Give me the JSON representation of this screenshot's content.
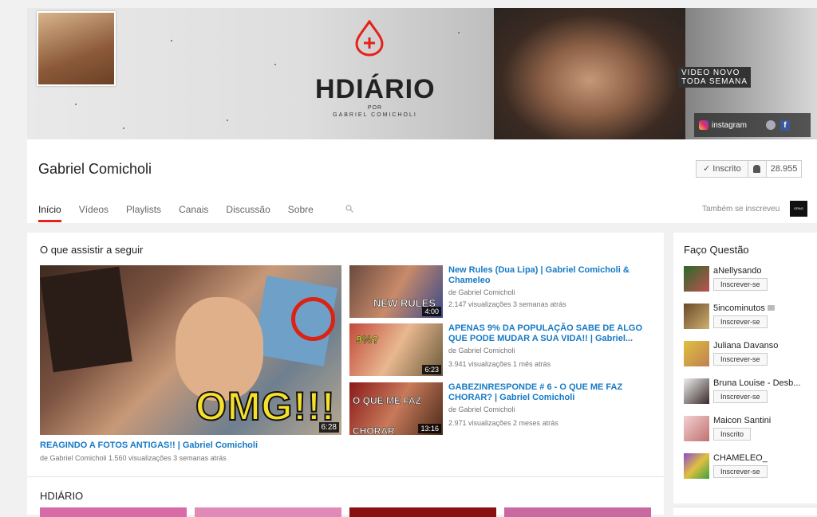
{
  "banner": {
    "logo_title": "HDIÁRIO",
    "logo_por": "POR",
    "logo_sub": "GABRIEL COMICHOLI",
    "video_novo_line1": "VIDEO NOVO",
    "video_novo_line2": "TODA SEMANA",
    "instagram_label": "instagram",
    "globe_icon": "globe-icon",
    "facebook_icon": "facebook-icon"
  },
  "header": {
    "channel_name": "Gabriel Comicholi",
    "subscribed_label": "✓ Inscrito",
    "subscriber_count": "28.955",
    "also_subscribed": "Também se inscreveu",
    "also_thumb_text": "GRAG"
  },
  "tabs": [
    {
      "label": "Início",
      "active": true
    },
    {
      "label": "Vídeos"
    },
    {
      "label": "Playlists"
    },
    {
      "label": "Canais"
    },
    {
      "label": "Discussão"
    },
    {
      "label": "Sobre"
    }
  ],
  "main": {
    "section_title": "O que assistir a seguir",
    "featured": {
      "title": "REAGINDO A FOTOS ANTIGAS!! | Gabriel Comicholi",
      "meta": "de Gabriel Comicholi  1.560 visualizações  3 semanas atrás",
      "duration": "6:28",
      "overlay_text": "OMG!!!"
    },
    "videos": [
      {
        "title": "New Rules (Dua Lipa) | Gabriel Comicholi & Chameleo",
        "by": "de Gabriel Comicholi",
        "stats": "2.147 visualizações  3 semanas atrás",
        "duration": "4:00",
        "thumb_text": "NEW RULES"
      },
      {
        "title": "APENAS 9% DA POPULAÇÃO SABE DE ALGO QUE PODE MUDAR A SUA VIDA!! | Gabriel...",
        "by": "de Gabriel Comicholi",
        "stats": "3.941 visualizações  1 mês atrás",
        "duration": "6:23",
        "thumb_text": "9%?"
      },
      {
        "title": "GABEZINRESPONDE # 6 - O QUE ME FAZ CHORAR? | Gabriel Comicholi",
        "by": "de Gabriel Comicholi",
        "stats": "2.971 visualizações  2 meses atrás",
        "duration": "13:16",
        "thumb_text": "O QUE ME FAZ CHORAR"
      }
    ],
    "second_section_title": "HDIÁRIO"
  },
  "sidebar": {
    "title": "Faço Questão",
    "channels": [
      {
        "name": "aNellysando",
        "button": "Inscrever-se"
      },
      {
        "name": "5incominutos",
        "button": "Inscrever-se"
      },
      {
        "name": "Juliana Davanso",
        "button": "Inscrever-se"
      },
      {
        "name": "Bruna Louise - Desb...",
        "button": "Inscrever-se"
      },
      {
        "name": "Maicon Santini",
        "button": "Inscrito"
      },
      {
        "name": "CHAMELEO_",
        "button": "Inscrever-se"
      }
    ]
  },
  "colors": {
    "accent_red": "#e62117",
    "link_blue": "#167ac6",
    "page_bg": "#f1f1f1"
  }
}
